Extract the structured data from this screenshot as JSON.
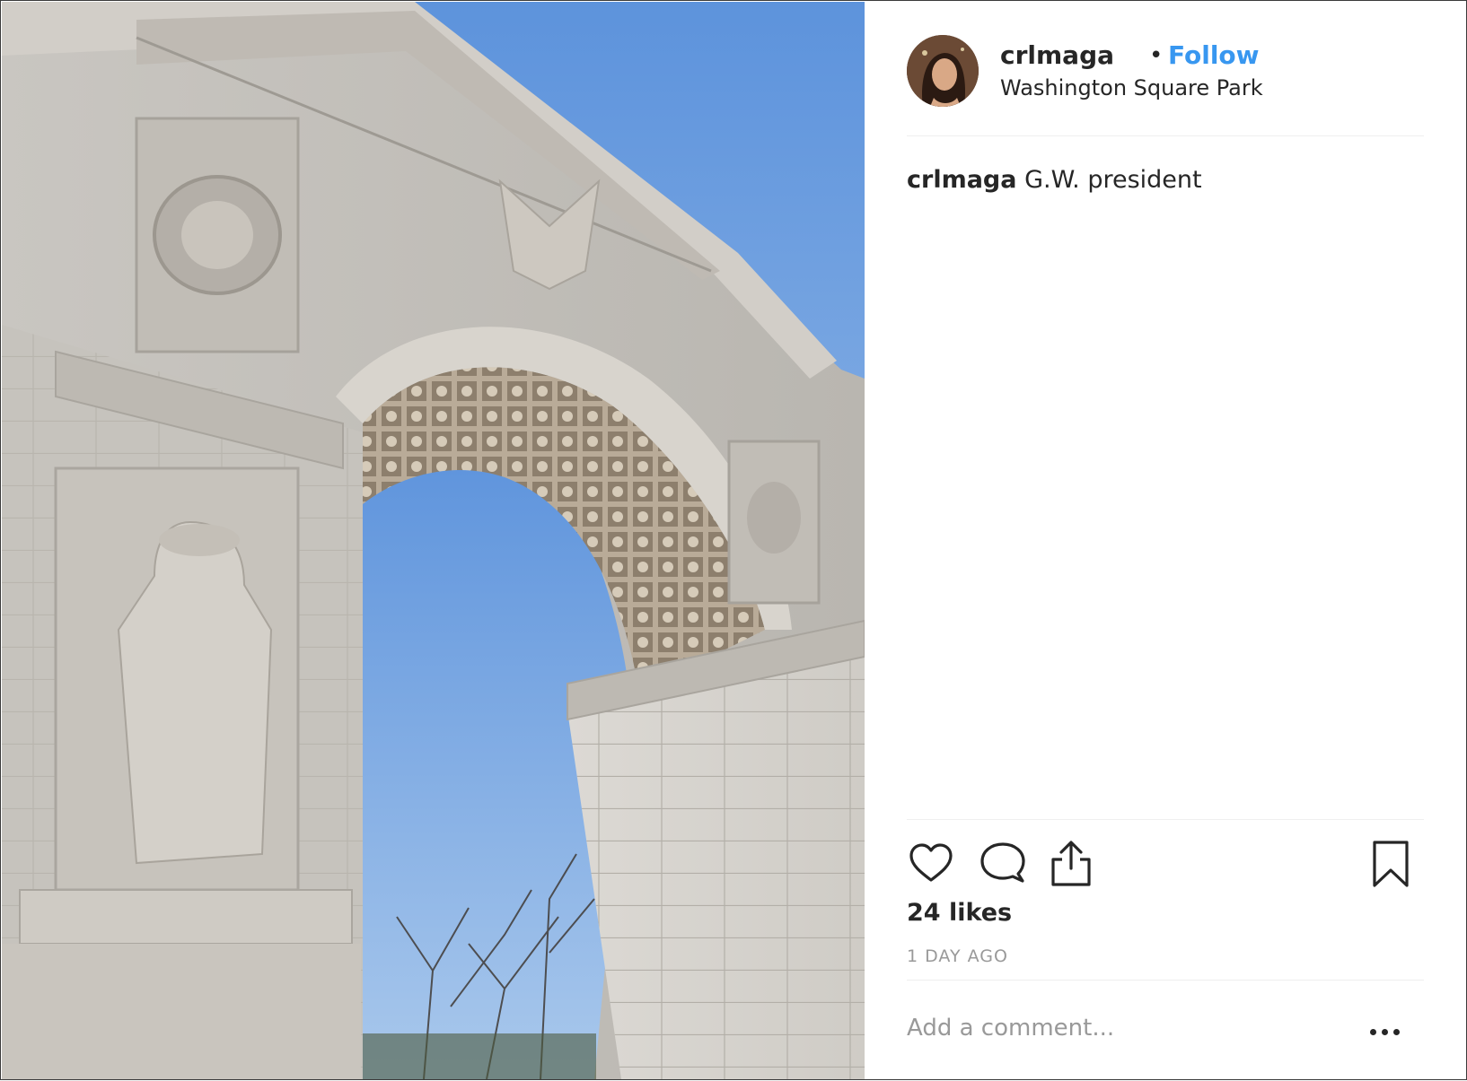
{
  "post": {
    "photo_alt": "Washington Square Arch",
    "author": {
      "username": "crlmaga",
      "separator": "•",
      "follow_label": "Follow",
      "location": "Washington Square Park"
    },
    "caption": {
      "username": "crlmaga",
      "text": "G.W. president"
    },
    "likes_text": "24 likes",
    "timestamp": "1 DAY AGO",
    "comment": {
      "placeholder": "Add a comment...",
      "value": ""
    }
  },
  "icons": {
    "like": "heart-icon",
    "comment": "comment-bubble-icon",
    "share": "share-icon",
    "save": "bookmark-icon",
    "more": "more-options-icon"
  },
  "colors": {
    "follow_link": "#3897f0",
    "text": "#262626",
    "secondary_text": "#999999",
    "divider": "#efefef"
  }
}
